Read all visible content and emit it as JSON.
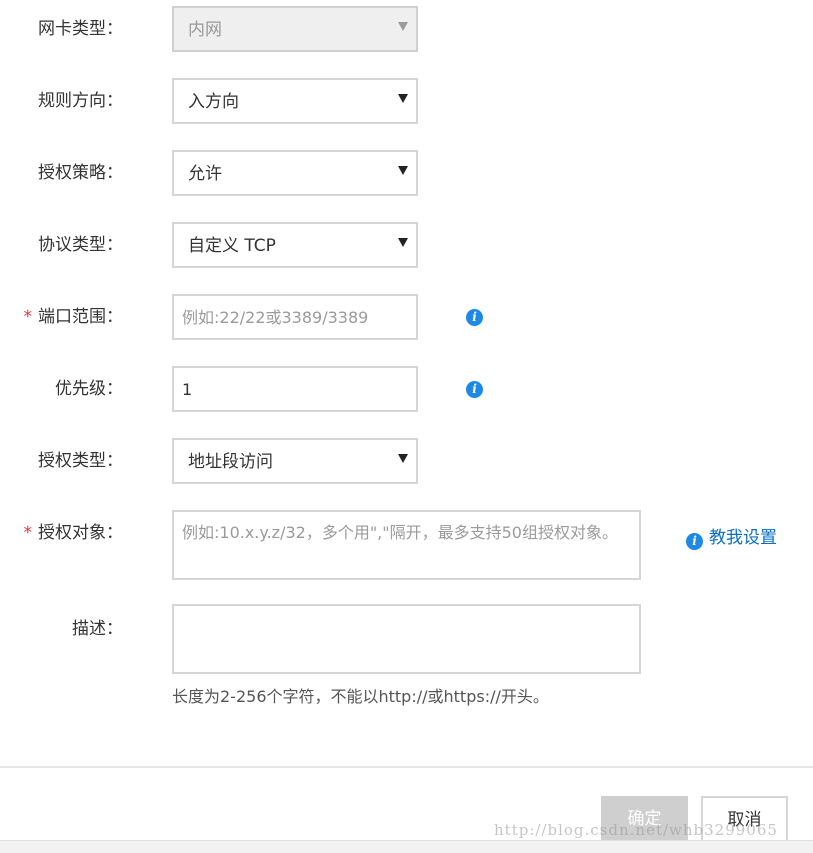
{
  "form": {
    "nic_type": {
      "label": "网卡类型：",
      "value": "内网"
    },
    "direction": {
      "label": "规则方向：",
      "value": "入方向"
    },
    "policy": {
      "label": "授权策略：",
      "value": "允许"
    },
    "protocol": {
      "label": "协议类型：",
      "value": "自定义 TCP"
    },
    "port_range": {
      "required_mark": "*",
      "label": "端口范围：",
      "placeholder": "例如:22/22或3389/3389",
      "value": ""
    },
    "priority": {
      "label": "优先级：",
      "value": "1"
    },
    "auth_type": {
      "label": "授权类型：",
      "value": "地址段访问"
    },
    "auth_object": {
      "required_mark": "*",
      "label": "授权对象：",
      "placeholder": "例如:10.x.y.z/32，多个用\",\"隔开，最多支持50组授权对象。",
      "help_link": "教我设置"
    },
    "description": {
      "label": "描述：",
      "value": "",
      "hint": "长度为2-256个字符，不能以http://或https://开头。"
    }
  },
  "icons": {
    "info": "info-icon",
    "caret": "chevron-down-icon"
  },
  "info_glyph": "i",
  "buttons": {
    "ok": "确定",
    "cancel": "取消"
  },
  "watermark": "http://blog.csdn.net/whb3299065",
  "colors": {
    "required": "#e4393c",
    "link": "#0b6fc7",
    "info": "#1e88e5",
    "ok_disabled": "#cfcfcf"
  }
}
